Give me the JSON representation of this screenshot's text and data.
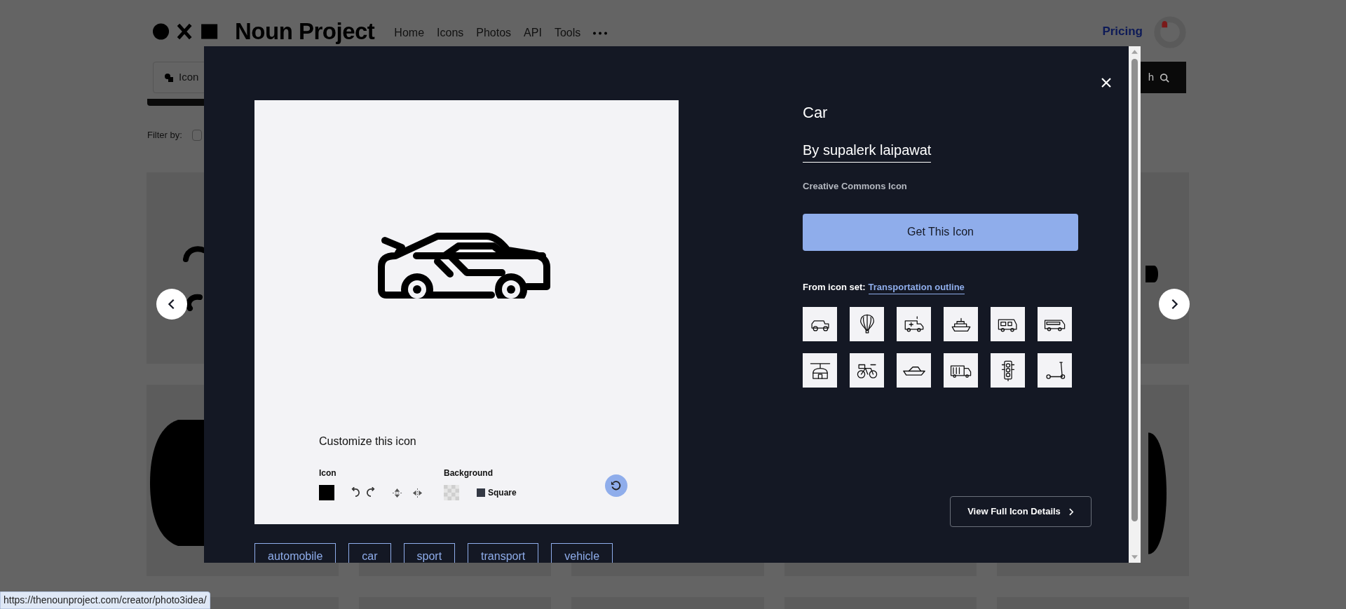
{
  "header": {
    "brand": "Noun Project",
    "nav": [
      "Home",
      "Icons",
      "Photos",
      "API",
      "Tools"
    ],
    "pricing": "Pricing"
  },
  "search": {
    "category": "Icon",
    "button": "h"
  },
  "filter_label": "Filter by:",
  "filter_checkbox": {
    "checked": false
  },
  "modal": {
    "title": "Car",
    "author": "By supalerk laipawat",
    "license": "Creative Commons Icon",
    "get_button": "Get This Icon",
    "set_label": "From icon set:",
    "set_name": "Transportation outline",
    "details_button": "View Full Icon Details",
    "customize": {
      "title": "Customize this icon",
      "icon_label": "Icon",
      "background_label": "Background",
      "shape": "Square"
    },
    "tags": [
      "automobile",
      "car",
      "sport",
      "transport",
      "vehicle"
    ]
  },
  "status_bar": "https://thenounproject.com/creator/photo3idea/"
}
